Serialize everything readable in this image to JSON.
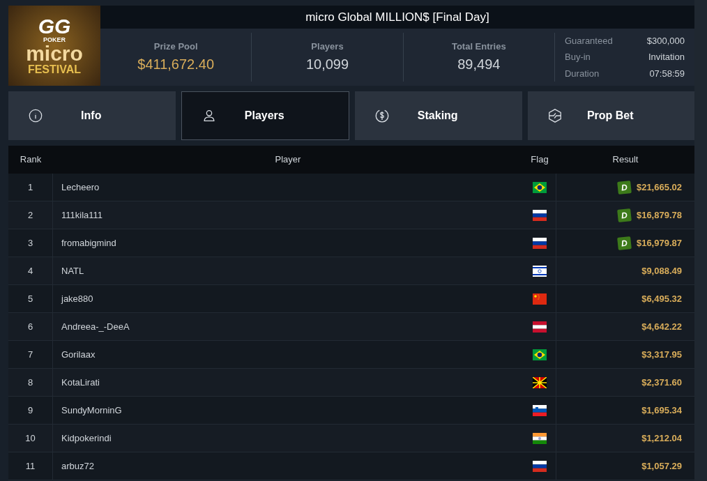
{
  "logo": {
    "lines": [
      "GG",
      "POKER",
      "micro",
      "FESTIVAL"
    ]
  },
  "title": "micro Global MILLION$ [Final Day]",
  "stats": [
    {
      "label": "Prize Pool",
      "value": "$411,672.40",
      "highlight": true
    },
    {
      "label": "Players",
      "value": "10,099",
      "highlight": false
    },
    {
      "label": "Total Entries",
      "value": "89,494",
      "highlight": false
    }
  ],
  "details": [
    {
      "label": "Guaranteed",
      "value": "$300,000"
    },
    {
      "label": "Buy-in",
      "value": "Invitation"
    },
    {
      "label": "Duration",
      "value": "07:58:59"
    }
  ],
  "tabs": [
    {
      "label": "Info",
      "kind": "info",
      "selected": false
    },
    {
      "label": "Players",
      "kind": "user",
      "selected": true
    },
    {
      "label": "Staking",
      "kind": "dollar",
      "selected": false
    },
    {
      "label": "Prop Bet",
      "kind": "bolt",
      "selected": false
    }
  ],
  "table": {
    "columns": [
      "Rank",
      "Player",
      "Flag",
      "Result"
    ],
    "rows": [
      {
        "rank": "1",
        "player": "Lecheero",
        "kind": "brazil",
        "badge": "D",
        "result": "$21,665.02"
      },
      {
        "rank": "2",
        "player": "111kila111",
        "kind": "russia",
        "badge": "D",
        "result": "$16,879.78"
      },
      {
        "rank": "3",
        "player": "fromabigmind",
        "kind": "russia",
        "badge": "D",
        "result": "$16,979.87"
      },
      {
        "rank": "4",
        "player": "NATL",
        "kind": "israel",
        "result": "$9,088.49"
      },
      {
        "rank": "5",
        "player": "jake880",
        "kind": "china",
        "result": "$6,495.32"
      },
      {
        "rank": "6",
        "player": "Andreea-_-DeeA",
        "kind": "austria",
        "result": "$4,642.22"
      },
      {
        "rank": "7",
        "player": "Gorilaax",
        "kind": "brazil",
        "result": "$3,317.95"
      },
      {
        "rank": "8",
        "player": "KotaLirati",
        "kind": "macedonia",
        "result": "$2,371.60"
      },
      {
        "rank": "9",
        "player": "SundyMorninG",
        "kind": "slovenia",
        "result": "$1,695.34"
      },
      {
        "rank": "10",
        "player": "Kidpokerindi",
        "kind": "india",
        "result": "$1,212.04"
      },
      {
        "rank": "11",
        "player": "arbuz72",
        "kind": "russia",
        "result": "$1,057.29"
      }
    ]
  }
}
